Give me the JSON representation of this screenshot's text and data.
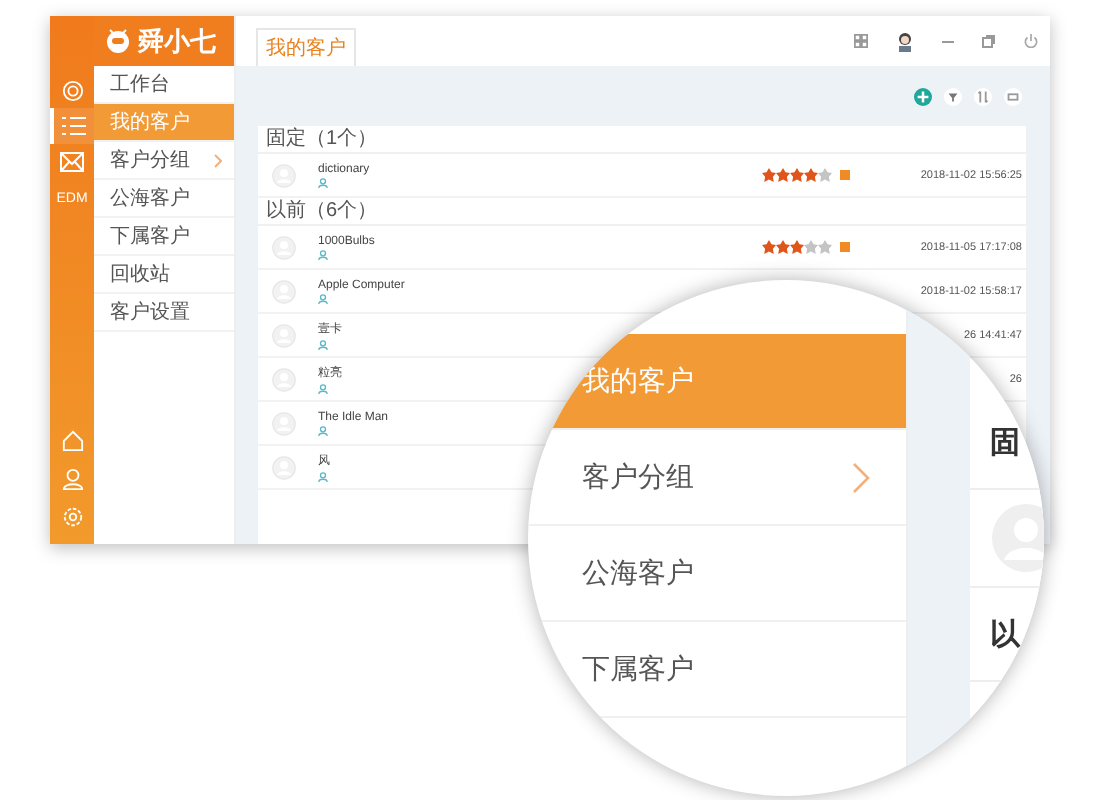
{
  "logo": "舜小七",
  "rail": [
    {
      "kind": "target",
      "selected": false
    },
    {
      "kind": "list",
      "selected": true
    },
    {
      "kind": "mail",
      "selected": false
    },
    {
      "kind": "text",
      "label": "EDM",
      "selected": false
    }
  ],
  "rail_bottom": [
    {
      "kind": "home"
    },
    {
      "kind": "user"
    },
    {
      "kind": "gear"
    }
  ],
  "nav": [
    {
      "label": "工作台",
      "selected": false,
      "submenu": false
    },
    {
      "label": "我的客户",
      "selected": true,
      "submenu": false
    },
    {
      "label": "客户分组",
      "selected": false,
      "submenu": true
    },
    {
      "label": "公海客户",
      "selected": false,
      "submenu": false
    },
    {
      "label": "下属客户",
      "selected": false,
      "submenu": false
    },
    {
      "label": "回收站",
      "selected": false,
      "submenu": false
    },
    {
      "label": "客户设置",
      "selected": false,
      "submenu": false
    }
  ],
  "tabs": [
    {
      "label": "我的客户",
      "selected": true
    }
  ],
  "sections": [
    {
      "title": "固定（1个）",
      "rows": [
        {
          "name": "dictionary",
          "stars": 4,
          "flagged": true,
          "date": "2018-11-02 15:56:25"
        }
      ]
    },
    {
      "title": "以前（6个）",
      "rows": [
        {
          "name": "1000Bulbs",
          "stars": 3,
          "flagged": true,
          "date": "2018-11-05 17:17:08"
        },
        {
          "name": "Apple Computer",
          "date": "2018-11-02 15:58:17"
        },
        {
          "name": "壹卡",
          "date": "26 14:41:47"
        },
        {
          "name": "粒亮",
          "date": "26"
        },
        {
          "name": "The Idle Man"
        },
        {
          "name": "风"
        }
      ]
    }
  ],
  "magnifier": {
    "nav": [
      {
        "label": "我的客户",
        "selected": true,
        "submenu": false
      },
      {
        "label": "客户分组",
        "selected": false,
        "submenu": true
      },
      {
        "label": "公海客户",
        "selected": false,
        "submenu": false
      },
      {
        "label": "下属客户",
        "selected": false,
        "submenu": false
      }
    ],
    "sections": [
      "固",
      "以"
    ]
  }
}
